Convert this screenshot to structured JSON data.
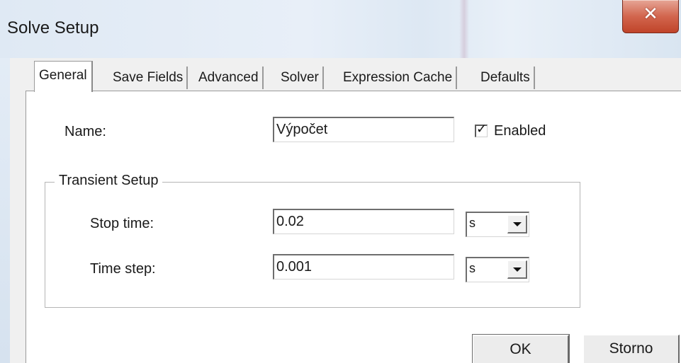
{
  "window": {
    "title": "Solve Setup",
    "close_glyph": "✕"
  },
  "tabs": [
    {
      "label": "General",
      "active": true
    },
    {
      "label": "Save Fields",
      "active": false
    },
    {
      "label": "Advanced",
      "active": false
    },
    {
      "label": "Solver",
      "active": false
    },
    {
      "label": "Expression Cache",
      "active": false
    },
    {
      "label": "Defaults",
      "active": false
    }
  ],
  "general": {
    "name_label": "Name:",
    "name_value": "Výpočet",
    "enabled_label": "Enabled",
    "enabled_checked": true,
    "check_glyph": "✓"
  },
  "transient": {
    "title": "Transient Setup",
    "stop_time_label": "Stop time:",
    "stop_time_value": "0.02",
    "stop_time_unit": "s",
    "time_step_label": "Time step:",
    "time_step_value": "0.001",
    "time_step_unit": "s"
  },
  "buttons": {
    "ok": "OK",
    "cancel": "Storno"
  },
  "icons": {
    "close": "close-icon",
    "check": "check-icon",
    "dropdown": "chevron-down-icon"
  },
  "colors": {
    "close_button": "#d2664e",
    "titlebar": "#dfe9f4",
    "dialog_bg": "#f0f0f0"
  }
}
